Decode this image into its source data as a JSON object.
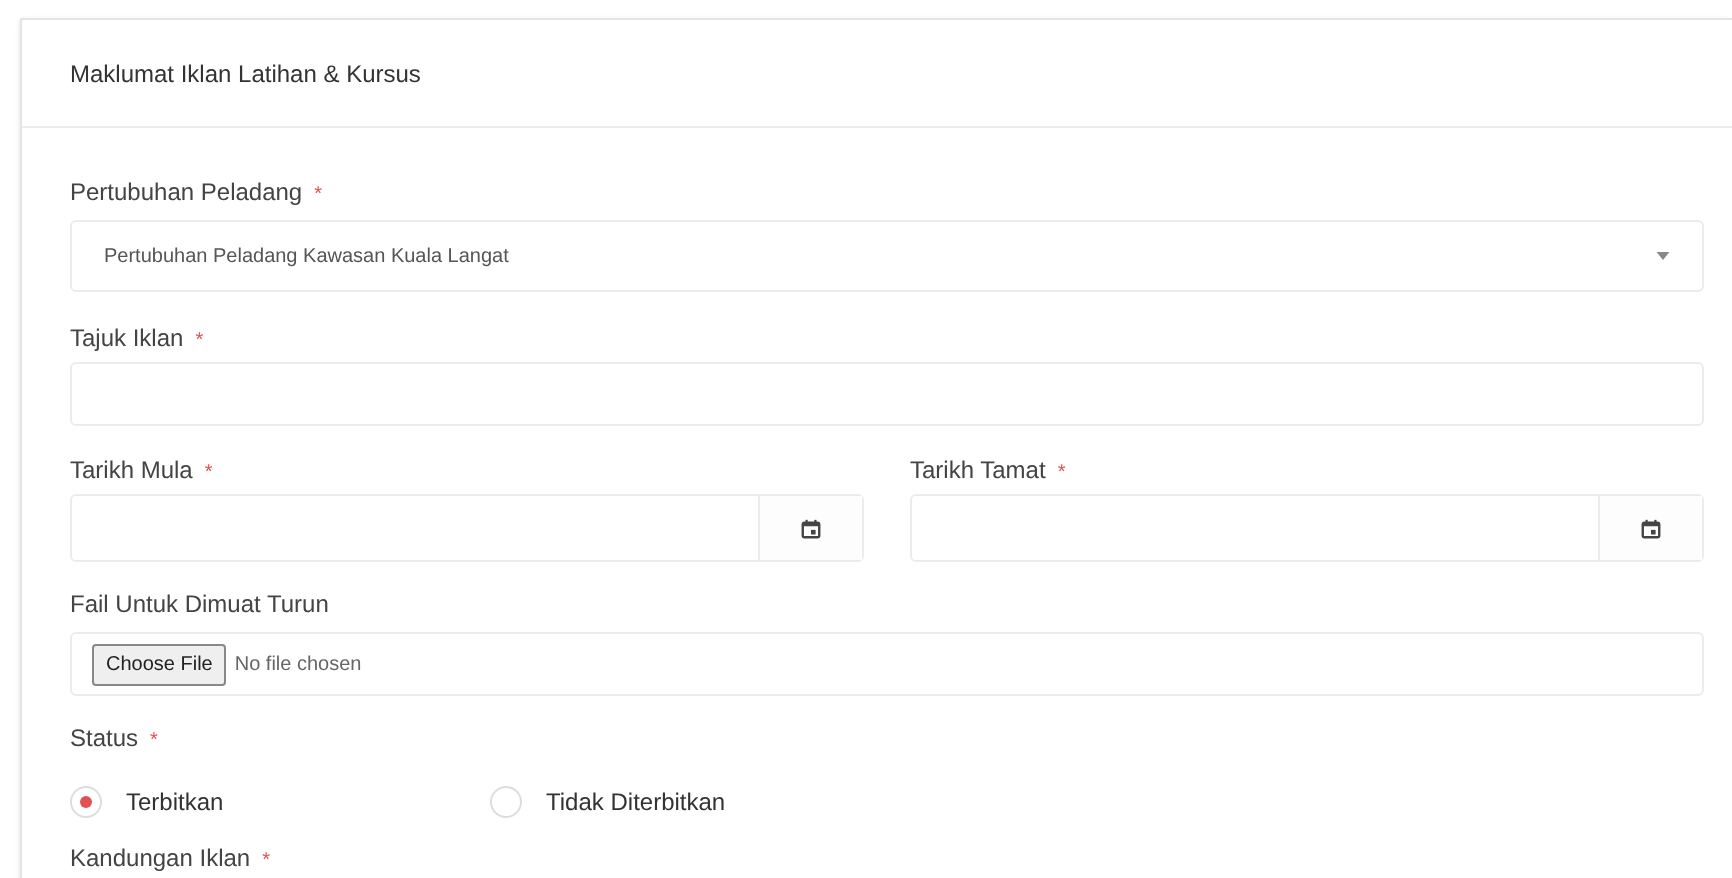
{
  "card": {
    "title": "Maklumat Iklan Latihan & Kursus"
  },
  "organisation": {
    "label": "Pertubuhan Peladang",
    "required_mark": "*",
    "value": "Pertubuhan Peladang Kawasan Kuala Langat"
  },
  "ad_title": {
    "label": "Tajuk Iklan",
    "required_mark": "*"
  },
  "dates": [
    {
      "label": "Tarikh Mula",
      "required_mark": "*"
    },
    {
      "label": "Tarikh Tamat",
      "required_mark": "*"
    }
  ],
  "file": {
    "label": "Fail Untuk Dimuat Turun",
    "button": "Choose File",
    "status": "No file chosen"
  },
  "status": {
    "label": "Status",
    "required_mark": "*",
    "options": [
      {
        "label": "Terbitkan",
        "selected": true
      },
      {
        "label": "Tidak Diterbitkan",
        "selected": false
      }
    ]
  },
  "content": {
    "label": "Kandungan Iklan",
    "required_mark": "*"
  }
}
